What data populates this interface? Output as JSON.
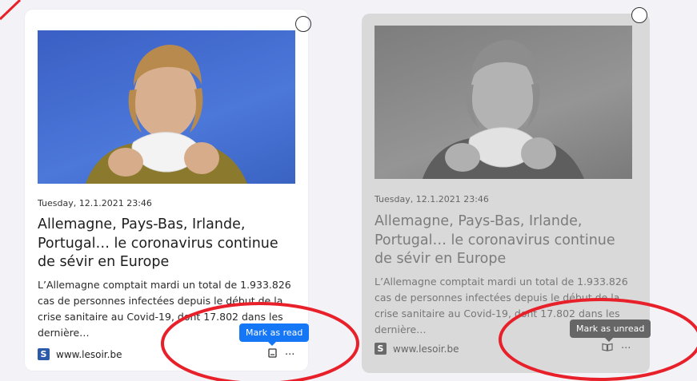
{
  "cards": [
    {
      "state": "unread",
      "timestamp": "Tuesday, 12.1.2021 23:46",
      "title": "Allemagne, Pays-Bas, Irlande, Portugal… le coronavirus continue de sévir en Europe",
      "excerpt": "L’Allemagne comptait mardi un total de 1.933.826 cas de personnes infectées depuis le début de la crise sanitaire au Covid-19, dont 17.802 dans les dernière…",
      "source": {
        "logo_letter": "S",
        "domain": "www.lesoir.be"
      },
      "tooltip": "Mark as read",
      "more_label": "···",
      "mark_icon": "mark-as-read-icon",
      "accent_color": "#1677f6"
    },
    {
      "state": "read",
      "timestamp": "Tuesday, 12.1.2021 23:46",
      "title": "Allemagne, Pays-Bas, Irlande, Portugal… le coronavirus continue de sévir en Europe",
      "excerpt": "L’Allemagne comptait mardi un total de 1.933.826 cas de personnes infectées depuis le début de la crise sanitaire au Covid-19, dont 17.802 dans les dernière…",
      "source": {
        "logo_letter": "S",
        "domain": "www.lesoir.be"
      },
      "tooltip": "Mark as unread",
      "more_label": "···",
      "mark_icon": "mark-as-unread-icon",
      "accent_color": "#666666"
    }
  ],
  "annotation_color": "#e8202a"
}
